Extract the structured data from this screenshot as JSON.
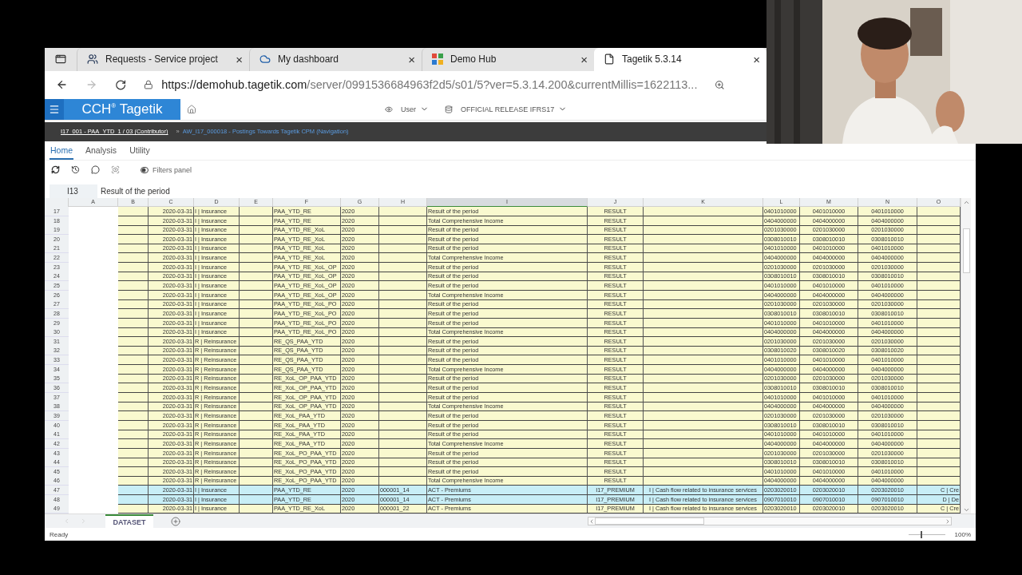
{
  "browser": {
    "tabs": [
      {
        "title": "Requests - Service project",
        "selected": false
      },
      {
        "title": "My dashboard",
        "selected": false
      },
      {
        "title": "Demo Hub",
        "selected": false
      },
      {
        "title": "Tagetik 5.3.14",
        "selected": true
      }
    ],
    "close_glyph": "×",
    "url_host": "https://demohub.tagetik.com",
    "url_path": "/server/0991536684963f2d5/s01/5?ver=5.3.14.200&currentMillis=1622113..."
  },
  "app": {
    "logo": "CCH$^{®}$ Tagetik",
    "user": "User",
    "release": "OFFICIAL RELEASE IFRS17"
  },
  "breadcrumb": {
    "current": "I17_001 - PAA_YTD_1 / 03 (Contributor)",
    "separator": "»",
    "link": "AW_I17_000018 - Postings Towards Tagetik CPM (Navigation)"
  },
  "ribbon_tabs": [
    {
      "label": "Home",
      "selected": true
    },
    {
      "label": "Analysis",
      "selected": false
    },
    {
      "label": "Utility",
      "selected": false
    }
  ],
  "toolbar": {
    "filters_panel": {
      "label": "Filters panel",
      "on": false
    }
  },
  "formula_bar": {
    "cell": "I13",
    "value": "Result of the period"
  },
  "sheet": {
    "columns": [
      {
        "label": "A",
        "selected": false
      },
      {
        "label": "B",
        "selected": false
      },
      {
        "label": "C",
        "selected": false
      },
      {
        "label": "D",
        "selected": false
      },
      {
        "label": "E",
        "selected": false
      },
      {
        "label": "F",
        "selected": false
      },
      {
        "label": "G",
        "selected": false
      },
      {
        "label": "H",
        "selected": false
      },
      {
        "label": "I",
        "selected": true
      },
      {
        "label": "J",
        "selected": false
      },
      {
        "label": "K",
        "selected": false
      },
      {
        "label": "L",
        "selected": false
      },
      {
        "label": "M",
        "selected": false
      },
      {
        "label": "N",
        "selected": false
      },
      {
        "label": "O",
        "selected": false
      }
    ],
    "rows": [
      {
        "number": "17",
        "highlighted": false,
        "col_c": "2020-03-31",
        "col_d": "I | Insurance",
        "col_f": "PAA_YTD_RE",
        "col_g": "2020",
        "col_i": "Result of the period",
        "col_j": "RESULT",
        "col_l": "0401010000",
        "col_m": "0401010000",
        "col_n": "0401010000"
      },
      {
        "number": "18",
        "highlighted": false,
        "col_c": "2020-03-31",
        "col_d": "I | Insurance",
        "col_f": "PAA_YTD_RE",
        "col_g": "2020",
        "col_i": "Total Comprehensive Income",
        "col_j": "RESULT",
        "col_l": "0404000000",
        "col_m": "0404000000",
        "col_n": "0404000000"
      },
      {
        "number": "19",
        "highlighted": false,
        "col_c": "2020-03-31",
        "col_d": "I | Insurance",
        "col_f": "PAA_YTD_RE_XoL",
        "col_g": "2020",
        "col_i": "Result of the period",
        "col_j": "RESULT",
        "col_l": "0201030000",
        "col_m": "0201030000",
        "col_n": "0201030000"
      },
      {
        "number": "20",
        "highlighted": false,
        "col_c": "2020-03-31",
        "col_d": "I | Insurance",
        "col_f": "PAA_YTD_RE_XoL",
        "col_g": "2020",
        "col_i": "Result of the period",
        "col_j": "RESULT",
        "col_l": "0308010010",
        "col_m": "0308010010",
        "col_n": "0308010010"
      },
      {
        "number": "21",
        "highlighted": false,
        "col_c": "2020-03-31",
        "col_d": "I | Insurance",
        "col_f": "PAA_YTD_RE_XoL",
        "col_g": "2020",
        "col_i": "Result of the period",
        "col_j": "RESULT",
        "col_l": "0401010000",
        "col_m": "0401010000",
        "col_n": "0401010000"
      },
      {
        "number": "22",
        "highlighted": false,
        "col_c": "2020-03-31",
        "col_d": "I | Insurance",
        "col_f": "PAA_YTD_RE_XoL",
        "col_g": "2020",
        "col_i": "Total Comprehensive Income",
        "col_j": "RESULT",
        "col_l": "0404000000",
        "col_m": "0404000000",
        "col_n": "0404000000"
      },
      {
        "number": "23",
        "highlighted": false,
        "col_c": "2020-03-31",
        "col_d": "I | Insurance",
        "col_f": "PAA_YTD_RE_XoL_OP",
        "col_g": "2020",
        "col_i": "Result of the period",
        "col_j": "RESULT",
        "col_l": "0201030000",
        "col_m": "0201030000",
        "col_n": "0201030000"
      },
      {
        "number": "24",
        "highlighted": false,
        "col_c": "2020-03-31",
        "col_d": "I | Insurance",
        "col_f": "PAA_YTD_RE_XoL_OP",
        "col_g": "2020",
        "col_i": "Result of the period",
        "col_j": "RESULT",
        "col_l": "0308010010",
        "col_m": "0308010010",
        "col_n": "0308010010"
      },
      {
        "number": "25",
        "highlighted": false,
        "col_c": "2020-03-31",
        "col_d": "I | Insurance",
        "col_f": "PAA_YTD_RE_XoL_OP",
        "col_g": "2020",
        "col_i": "Result of the period",
        "col_j": "RESULT",
        "col_l": "0401010000",
        "col_m": "0401010000",
        "col_n": "0401010000"
      },
      {
        "number": "26",
        "highlighted": false,
        "col_c": "2020-03-31",
        "col_d": "I | Insurance",
        "col_f": "PAA_YTD_RE_XoL_OP",
        "col_g": "2020",
        "col_i": "Total Comprehensive Income",
        "col_j": "RESULT",
        "col_l": "0404000000",
        "col_m": "0404000000",
        "col_n": "0404000000"
      },
      {
        "number": "27",
        "highlighted": false,
        "col_c": "2020-03-31",
        "col_d": "I | Insurance",
        "col_f": "PAA_YTD_RE_XoL_PO",
        "col_g": "2020",
        "col_i": "Result of the period",
        "col_j": "RESULT",
        "col_l": "0201030000",
        "col_m": "0201030000",
        "col_n": "0201030000"
      },
      {
        "number": "28",
        "highlighted": false,
        "col_c": "2020-03-31",
        "col_d": "I | Insurance",
        "col_f": "PAA_YTD_RE_XoL_PO",
        "col_g": "2020",
        "col_i": "Result of the period",
        "col_j": "RESULT",
        "col_l": "0308010010",
        "col_m": "0308010010",
        "col_n": "0308010010"
      },
      {
        "number": "29",
        "highlighted": false,
        "col_c": "2020-03-31",
        "col_d": "I | Insurance",
        "col_f": "PAA_YTD_RE_XoL_PO",
        "col_g": "2020",
        "col_i": "Result of the period",
        "col_j": "RESULT",
        "col_l": "0401010000",
        "col_m": "0401010000",
        "col_n": "0401010000"
      },
      {
        "number": "30",
        "highlighted": false,
        "col_c": "2020-03-31",
        "col_d": "I | Insurance",
        "col_f": "PAA_YTD_RE_XoL_PO",
        "col_g": "2020",
        "col_i": "Total Comprehensive Income",
        "col_j": "RESULT",
        "col_l": "0404000000",
        "col_m": "0404000000",
        "col_n": "0404000000"
      },
      {
        "number": "31",
        "highlighted": false,
        "col_c": "2020-03-31",
        "col_d": "R | Reinsurance",
        "col_f": "RE_QS_PAA_YTD",
        "col_g": "2020",
        "col_i": "Result of the period",
        "col_j": "RESULT",
        "col_l": "0201030000",
        "col_m": "0201030000",
        "col_n": "0201030000"
      },
      {
        "number": "32",
        "highlighted": false,
        "col_c": "2020-03-31",
        "col_d": "R | Reinsurance",
        "col_f": "RE_QS_PAA_YTD",
        "col_g": "2020",
        "col_i": "Result of the period",
        "col_j": "RESULT",
        "col_l": "0308010020",
        "col_m": "0308010020",
        "col_n": "0308010020"
      },
      {
        "number": "33",
        "highlighted": false,
        "col_c": "2020-03-31",
        "col_d": "R | Reinsurance",
        "col_f": "RE_QS_PAA_YTD",
        "col_g": "2020",
        "col_i": "Result of the period",
        "col_j": "RESULT",
        "col_l": "0401010000",
        "col_m": "0401010000",
        "col_n": "0401010000"
      },
      {
        "number": "34",
        "highlighted": false,
        "col_c": "2020-03-31",
        "col_d": "R | Reinsurance",
        "col_f": "RE_QS_PAA_YTD",
        "col_g": "2020",
        "col_i": "Total Comprehensive Income",
        "col_j": "RESULT",
        "col_l": "0404000000",
        "col_m": "0404000000",
        "col_n": "0404000000"
      },
      {
        "number": "35",
        "highlighted": false,
        "col_c": "2020-03-31",
        "col_d": "R | Reinsurance",
        "col_f": "RE_XoL_OP_PAA_YTD",
        "col_g": "2020",
        "col_i": "Result of the period",
        "col_j": "RESULT",
        "col_l": "0201030000",
        "col_m": "0201030000",
        "col_n": "0201030000"
      },
      {
        "number": "36",
        "highlighted": false,
        "col_c": "2020-03-31",
        "col_d": "R | Reinsurance",
        "col_f": "RE_XoL_OP_PAA_YTD",
        "col_g": "2020",
        "col_i": "Result of the period",
        "col_j": "RESULT",
        "col_l": "0308010010",
        "col_m": "0308010010",
        "col_n": "0308010010"
      },
      {
        "number": "37",
        "highlighted": false,
        "col_c": "2020-03-31",
        "col_d": "R | Reinsurance",
        "col_f": "RE_XoL_OP_PAA_YTD",
        "col_g": "2020",
        "col_i": "Result of the period",
        "col_j": "RESULT",
        "col_l": "0401010000",
        "col_m": "0401010000",
        "col_n": "0401010000"
      },
      {
        "number": "38",
        "highlighted": false,
        "col_c": "2020-03-31",
        "col_d": "R | Reinsurance",
        "col_f": "RE_XoL_OP_PAA_YTD",
        "col_g": "2020",
        "col_i": "Total Comprehensive Income",
        "col_j": "RESULT",
        "col_l": "0404000000",
        "col_m": "0404000000",
        "col_n": "0404000000"
      },
      {
        "number": "39",
        "highlighted": false,
        "col_c": "2020-03-31",
        "col_d": "R | Reinsurance",
        "col_f": "RE_XoL_PAA_YTD",
        "col_g": "2020",
        "col_i": "Result of the period",
        "col_j": "RESULT",
        "col_l": "0201030000",
        "col_m": "0201030000",
        "col_n": "0201030000"
      },
      {
        "number": "40",
        "highlighted": false,
        "col_c": "2020-03-31",
        "col_d": "R | Reinsurance",
        "col_f": "RE_XoL_PAA_YTD",
        "col_g": "2020",
        "col_i": "Result of the period",
        "col_j": "RESULT",
        "col_l": "0308010010",
        "col_m": "0308010010",
        "col_n": "0308010010"
      },
      {
        "number": "41",
        "highlighted": false,
        "col_c": "2020-03-31",
        "col_d": "R | Reinsurance",
        "col_f": "RE_XoL_PAA_YTD",
        "col_g": "2020",
        "col_i": "Result of the period",
        "col_j": "RESULT",
        "col_l": "0401010000",
        "col_m": "0401010000",
        "col_n": "0401010000"
      },
      {
        "number": "42",
        "highlighted": false,
        "col_c": "2020-03-31",
        "col_d": "R | Reinsurance",
        "col_f": "RE_XoL_PAA_YTD",
        "col_g": "2020",
        "col_i": "Total Comprehensive Income",
        "col_j": "RESULT",
        "col_l": "0404000000",
        "col_m": "0404000000",
        "col_n": "0404000000"
      },
      {
        "number": "43",
        "highlighted": false,
        "col_c": "2020-03-31",
        "col_d": "R | Reinsurance",
        "col_f": "RE_XoL_PO_PAA_YTD",
        "col_g": "2020",
        "col_i": "Result of the period",
        "col_j": "RESULT",
        "col_l": "0201030000",
        "col_m": "0201030000",
        "col_n": "0201030000"
      },
      {
        "number": "44",
        "highlighted": false,
        "col_c": "2020-03-31",
        "col_d": "R | Reinsurance",
        "col_f": "RE_XoL_PO_PAA_YTD",
        "col_g": "2020",
        "col_i": "Result of the period",
        "col_j": "RESULT",
        "col_l": "0308010010",
        "col_m": "0308010010",
        "col_n": "0308010010"
      },
      {
        "number": "45",
        "highlighted": false,
        "col_c": "2020-03-31",
        "col_d": "R | Reinsurance",
        "col_f": "RE_XoL_PO_PAA_YTD",
        "col_g": "2020",
        "col_i": "Result of the period",
        "col_j": "RESULT",
        "col_l": "0401010000",
        "col_m": "0401010000",
        "col_n": "0401010000"
      },
      {
        "number": "46",
        "highlighted": false,
        "col_c": "2020-03-31",
        "col_d": "R | Reinsurance",
        "col_f": "RE_XoL_PO_PAA_YTD",
        "col_g": "2020",
        "col_i": "Total Comprehensive Income",
        "col_j": "RESULT",
        "col_l": "0404000000",
        "col_m": "0404000000",
        "col_n": "0404000000"
      },
      {
        "number": "47",
        "highlighted": true,
        "col_c": "2020-03-31",
        "col_d": "I | Insurance",
        "col_f": "PAA_YTD_RE",
        "col_g": "2020",
        "col_h": "000001_14",
        "col_i": "ACT - Premiums",
        "col_j": "I17_PREMIUM",
        "col_k": "I | Cash flow related to insurance services",
        "col_l": "0203020010",
        "col_m": "0203020010",
        "col_n": "0203020010",
        "col_o": "C | Cre"
      },
      {
        "number": "48",
        "highlighted": true,
        "col_c": "2020-03-31",
        "col_d": "I | Insurance",
        "col_f": "PAA_YTD_RE",
        "col_g": "2020",
        "col_h": "000001_14",
        "col_i": "ACT - Premiums",
        "col_j": "I17_PREMIUM",
        "col_k": "I | Cash flow related to insurance services",
        "col_l": "0907010010",
        "col_m": "0907010010",
        "col_n": "0907010010",
        "col_o": "D | De"
      },
      {
        "number": "49",
        "highlighted": false,
        "col_c": "2020-03-31",
        "col_d": "I | Insurance",
        "col_f": "PAA_YTD_RE_XoL",
        "col_g": "2020",
        "col_h": "000001_22",
        "col_i": "ACT - Premiums",
        "col_j": "I17_PREMIUM",
        "col_k": "I | Cash flow related to insurance services",
        "col_l": "0203020010",
        "col_m": "0203020010",
        "col_n": "0203020010",
        "col_o": "C | Cre"
      }
    ],
    "sheet_tabs": [
      {
        "label": "DATASET",
        "selected": true
      }
    ]
  },
  "status_bar": {
    "status": "Ready",
    "zoom": {
      "level": 0.33,
      "reading": "100%"
    }
  }
}
